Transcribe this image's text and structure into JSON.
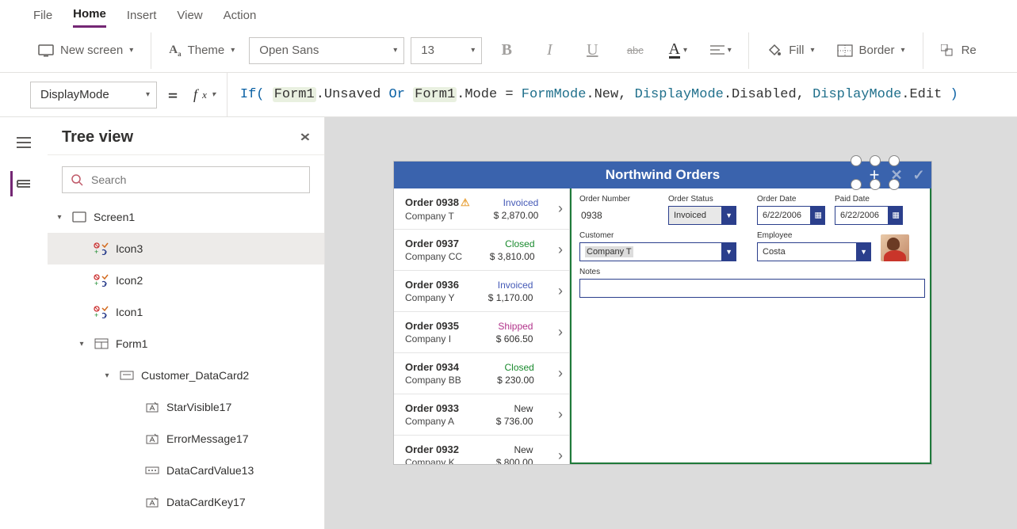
{
  "menu": {
    "items": [
      "File",
      "Home",
      "Insert",
      "View",
      "Action"
    ],
    "activeIndex": 1
  },
  "ribbon": {
    "newScreen": "New screen",
    "theme": "Theme",
    "font": "Open Sans",
    "fontSize": "13",
    "fill": "Fill",
    "border": "Border",
    "reorder": "Re"
  },
  "propertySelect": "DisplayMode",
  "formula": {
    "tokens": [
      {
        "t": "If(",
        "c": "kw"
      },
      {
        "t": " ",
        "c": "plain"
      },
      {
        "t": "Form1",
        "c": "ref"
      },
      {
        "t": ".Unsaved ",
        "c": "plain"
      },
      {
        "t": "Or",
        "c": "kw"
      },
      {
        "t": " ",
        "c": "plain"
      },
      {
        "t": "Form1",
        "c": "ref"
      },
      {
        "t": ".Mode ",
        "c": "plain"
      },
      {
        "t": "=",
        "c": "plain"
      },
      {
        "t": " ",
        "c": "plain"
      },
      {
        "t": "FormMode",
        "c": "type"
      },
      {
        "t": ".New, ",
        "c": "plain"
      },
      {
        "t": "DisplayMode",
        "c": "type"
      },
      {
        "t": ".Disabled, ",
        "c": "plain"
      },
      {
        "t": "DisplayMode",
        "c": "type"
      },
      {
        "t": ".Edit ",
        "c": "plain"
      },
      {
        "t": ")",
        "c": "kw"
      }
    ]
  },
  "treeView": {
    "title": "Tree view",
    "searchPlaceholder": "Search",
    "nodes": [
      {
        "label": "Screen1",
        "glyph": "screen",
        "indent": 0,
        "caret": "▾"
      },
      {
        "label": "Icon3",
        "glyph": "icongrp",
        "indent": 1,
        "caret": "",
        "selected": true
      },
      {
        "label": "Icon2",
        "glyph": "icongrp",
        "indent": 1,
        "caret": ""
      },
      {
        "label": "Icon1",
        "glyph": "icongrp",
        "indent": 1,
        "caret": ""
      },
      {
        "label": "Form1",
        "glyph": "form",
        "indent": 1,
        "caret": "▾"
      },
      {
        "label": "Customer_DataCard2",
        "glyph": "card",
        "indent": 2,
        "caret": "▾"
      },
      {
        "label": "StarVisible17",
        "glyph": "label",
        "indent": 3,
        "caret": ""
      },
      {
        "label": "ErrorMessage17",
        "glyph": "label",
        "indent": 3,
        "caret": ""
      },
      {
        "label": "DataCardValue13",
        "glyph": "input",
        "indent": 3,
        "caret": ""
      },
      {
        "label": "DataCardKey17",
        "glyph": "label",
        "indent": 3,
        "caret": ""
      }
    ]
  },
  "app": {
    "title": "Northwind Orders",
    "orders": [
      {
        "order": "Order 0938",
        "warn": true,
        "company": "Company T",
        "status": "Invoiced",
        "statusColor": "#4459b6",
        "amount": "$ 2,870.00"
      },
      {
        "order": "Order 0937",
        "warn": false,
        "company": "Company CC",
        "status": "Closed",
        "statusColor": "#1a8a2e",
        "amount": "$ 3,810.00"
      },
      {
        "order": "Order 0936",
        "warn": false,
        "company": "Company Y",
        "status": "Invoiced",
        "statusColor": "#4459b6",
        "amount": "$ 1,170.00"
      },
      {
        "order": "Order 0935",
        "warn": false,
        "company": "Company I",
        "status": "Shipped",
        "statusColor": "#b2348b",
        "amount": "$ 606.50"
      },
      {
        "order": "Order 0934",
        "warn": false,
        "company": "Company BB",
        "status": "Closed",
        "statusColor": "#1a8a2e",
        "amount": "$ 230.00"
      },
      {
        "order": "Order 0933",
        "warn": false,
        "company": "Company A",
        "status": "New",
        "statusColor": "#333",
        "amount": "$ 736.00"
      },
      {
        "order": "Order 0932",
        "warn": false,
        "company": "Company K",
        "status": "New",
        "statusColor": "#333",
        "amount": "$ 800.00"
      }
    ],
    "form": {
      "orderNumberLabel": "Order Number",
      "orderNumber": "0938",
      "orderStatusLabel": "Order Status",
      "orderStatus": "Invoiced",
      "orderDateLabel": "Order Date",
      "orderDate": "6/22/2006",
      "paidDateLabel": "Paid Date",
      "paidDate": "6/22/2006",
      "customerLabel": "Customer",
      "customer": "Company T",
      "employeeLabel": "Employee",
      "employee": "Costa",
      "notesLabel": "Notes",
      "notes": ""
    }
  }
}
